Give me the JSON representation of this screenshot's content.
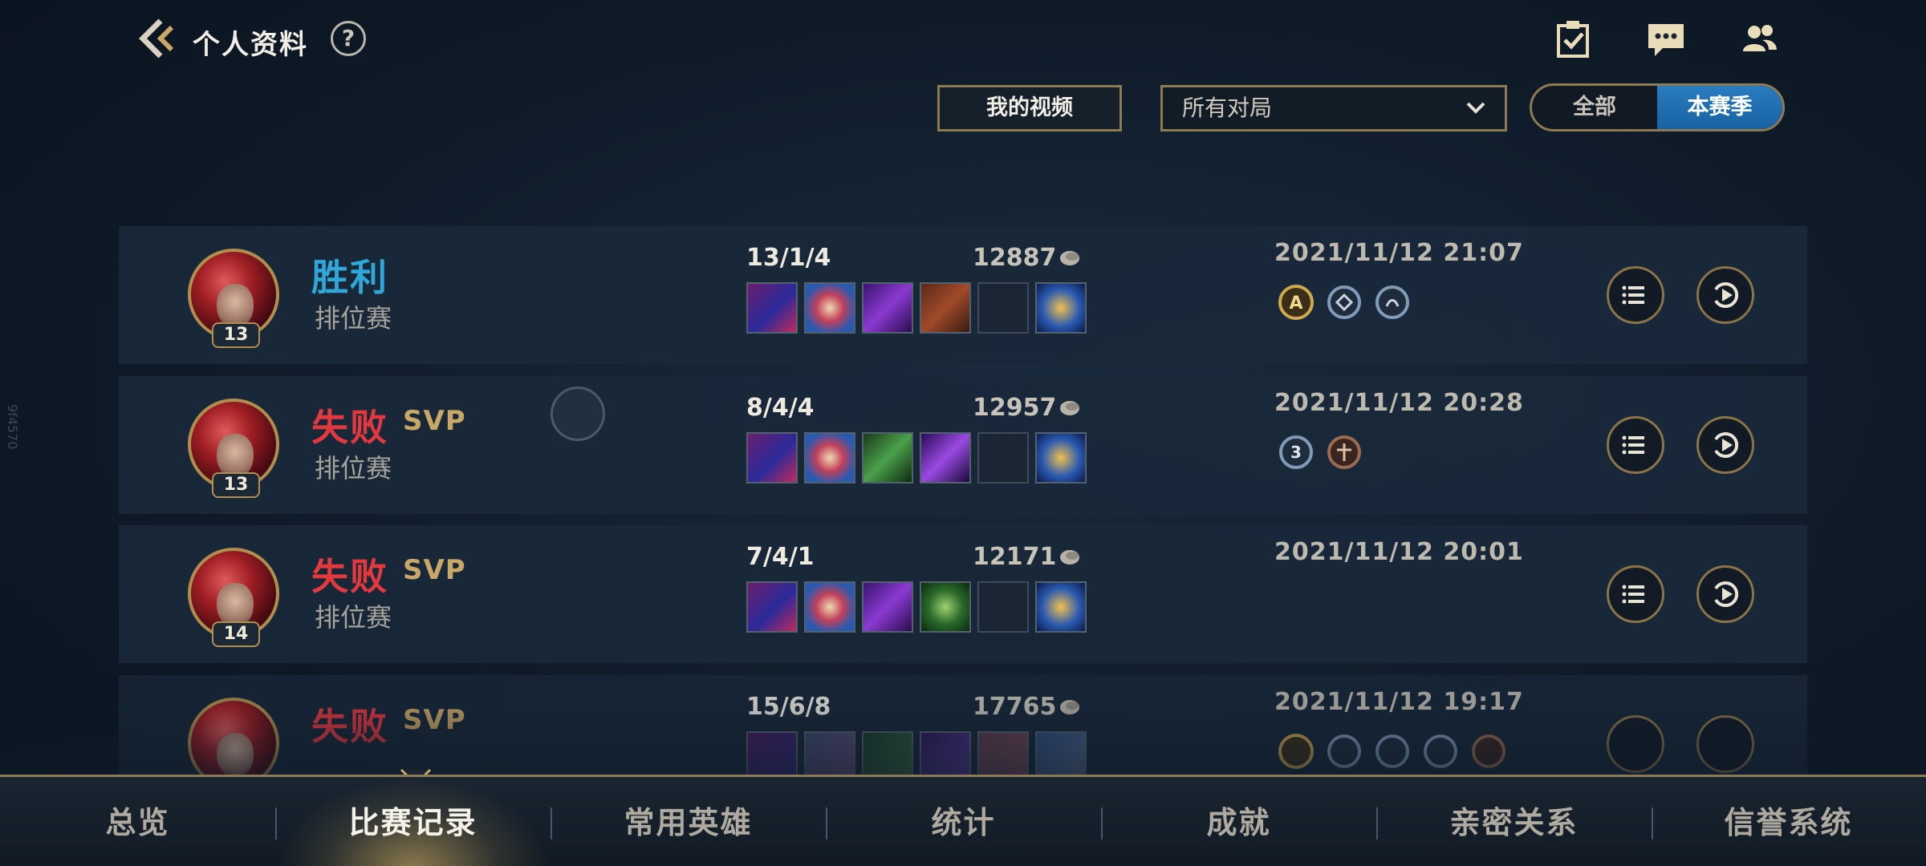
{
  "header": {
    "title": "个人资料",
    "help_label": "?"
  },
  "controls": {
    "my_videos_label": "我的视频",
    "match_filter_value": "所有对局",
    "toggle": {
      "all_label": "全部",
      "season_label": "本赛季",
      "active": "本赛季"
    }
  },
  "matches": [
    {
      "result": "胜利",
      "result_type": "win",
      "svp": "",
      "mode": "排位赛",
      "level": "13",
      "kda": "13/1/4",
      "gold": "12887",
      "datetime": "2021/11/12 21:07",
      "badge_count": 3
    },
    {
      "result": "失败",
      "result_type": "loss",
      "svp": "SVP",
      "mode": "排位赛",
      "level": "13",
      "kda": "8/4/4",
      "gold": "12957",
      "datetime": "2021/11/12 20:28",
      "badge_count": 2
    },
    {
      "result": "失败",
      "result_type": "loss",
      "svp": "SVP",
      "mode": "排位赛",
      "level": "14",
      "kda": "7/4/1",
      "gold": "12171",
      "datetime": "2021/11/12 20:01",
      "badge_count": 0
    },
    {
      "result": "失败",
      "result_type": "loss",
      "svp": "SVP",
      "mode": "",
      "level": "",
      "kda": "15/6/8",
      "gold": "17765",
      "datetime": "2021/11/12 19:17",
      "badge_count": 5
    }
  ],
  "bottom_nav": {
    "items": [
      "总览",
      "比赛记录",
      "常用英雄",
      "统计",
      "成就",
      "亲密关系",
      "信誉系统"
    ],
    "active_index": 1
  },
  "watermark": "9f4570",
  "colors": {
    "accent_gold": "#8d7a52",
    "win": "#2fa8d9",
    "loss": "#e2383e",
    "toggle_active": "#1f6fb2"
  }
}
